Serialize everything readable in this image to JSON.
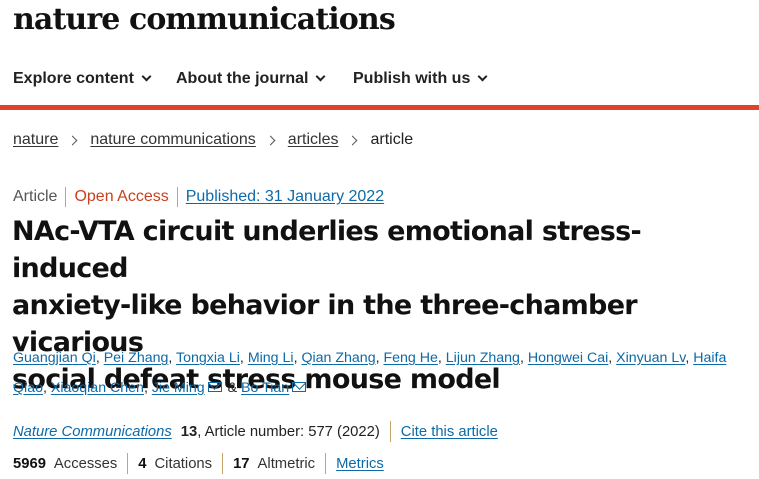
{
  "site": {
    "logo": "nature communications"
  },
  "nav": {
    "items": [
      {
        "label": "Explore content"
      },
      {
        "label": "About the journal"
      },
      {
        "label": "Publish with us"
      }
    ]
  },
  "breadcrumb": [
    "nature",
    "nature communications",
    "articles",
    "article"
  ],
  "article": {
    "type": "Article",
    "access": "Open Access",
    "published": "Published: 31 January 2022",
    "title_lines": [
      "NAc-VTA circuit underlies emotional stress-induced",
      "anxiety-like behavior in the three-chamber vicarious",
      "social defeat stress mouse model"
    ],
    "authors": [
      "Guangjian Qi",
      "Pei Zhang",
      "Tongxia Li",
      "Ming Li",
      "Qian Zhang",
      "Feng He",
      "Lijun Zhang",
      "Hongwei Cai",
      "Xinyuan Lv",
      "Haifa Qiao",
      "Xiaoqian Chen",
      "Jie Ming",
      "Bo Tian"
    ],
    "and_word": "&",
    "journal_name": "Nature Communications",
    "volume": "13",
    "article_number": ", Article number: 577 (2022)",
    "cite_label": "Cite this article"
  },
  "metrics": {
    "accesses_value": "5969",
    "accesses_label": "Accesses",
    "citations_value": "4",
    "citations_label": "Citations",
    "altmetric_value": "17",
    "altmetric_label": "Altmetric",
    "metrics_link": "Metrics"
  },
  "icons": {
    "nav_dropdown": "chevron-down-icon",
    "breadcrumb_sep": "chevron-right-icon",
    "email": "email-icon"
  },
  "colors": {
    "accent_red": "#e0422b",
    "link_blue": "#0c6aa8",
    "open_access": "#c7411e"
  }
}
